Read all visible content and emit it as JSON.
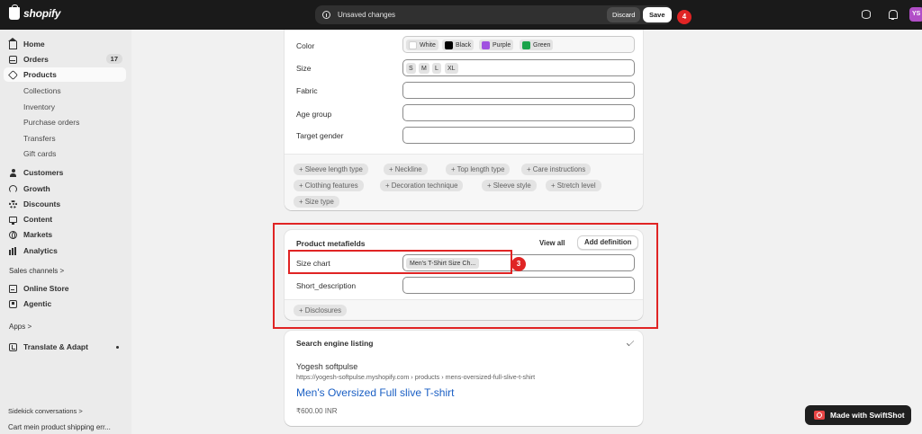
{
  "app": {
    "brand": "shopify"
  },
  "topbar": {
    "unsaved_text": "Unsaved changes",
    "discard_label": "Discard",
    "save_label": "Save",
    "save_step": "4",
    "avatar_initials": "YS"
  },
  "sidebar": {
    "home": "Home",
    "orders": "Orders",
    "orders_count": "17",
    "products": "Products",
    "product_sub": [
      "Collections",
      "Inventory",
      "Purchase orders",
      "Transfers",
      "Gift cards"
    ],
    "customers": "Customers",
    "growth": "Growth",
    "discounts": "Discounts",
    "content": "Content",
    "markets": "Markets",
    "analytics": "Analytics",
    "sales_channels": "Sales channels >",
    "online_store": "Online Store",
    "agentic": "Agentic",
    "apps": "Apps >",
    "translate": "Translate & Adapt",
    "sidekick_title": "Sidekick conversations >",
    "sidekick_item": "Cart mein product shipping err..."
  },
  "category_metafields": {
    "color_label": "Color",
    "colors": [
      {
        "name": "White",
        "hex": "#ffffff"
      },
      {
        "name": "Black",
        "hex": "#000000"
      },
      {
        "name": "Purple",
        "hex": "#a052e0"
      },
      {
        "name": "Green",
        "hex": "#1aa34a"
      }
    ],
    "size_label": "Size",
    "sizes": [
      "S",
      "M",
      "L",
      "XL"
    ],
    "fabric_label": "Fabric",
    "age_group_label": "Age group",
    "target_gender_label": "Target gender",
    "suggestions": [
      "+ Sleeve length type",
      "+ Neckline",
      "+ Top length type",
      "+ Care instructions",
      "+ Clothing features",
      "+ Decoration technique",
      "+ Sleeve style",
      "+ Stretch level",
      "+ Size type"
    ]
  },
  "product_metafields": {
    "title": "Product metafields",
    "view_all": "View all",
    "add_definition": "Add definition",
    "size_chart_label": "Size chart",
    "size_chart_value": "Men's T-Shirt Size Ch...",
    "size_chart_step": "3",
    "short_description_label": "Short_description",
    "disclosures": "+ Disclosures"
  },
  "seo": {
    "title": "Search engine listing",
    "store_name": "Yogesh softpulse",
    "url": "https://yogesh-softpulse.myshopify.com › products › mens-oversized-full-slive-t-shirt",
    "page_title": "Men's Oversized Full slive T-shirt",
    "price": "₹600.00 INR"
  },
  "swiftshot": {
    "label": "Made with SwiftShot"
  }
}
